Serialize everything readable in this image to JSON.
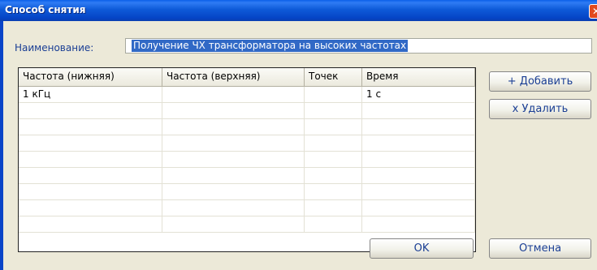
{
  "window": {
    "title": "Способ снятия",
    "close_glyph": "✕"
  },
  "form": {
    "name_label": "Наименование:",
    "name_value": "Получение ЧХ трансформатора на высоких частотах"
  },
  "grid": {
    "columns": [
      "Частота (нижняя)",
      "Частота (верхняя)",
      "Точек",
      "Время"
    ],
    "rows": [
      [
        "1 кГц",
        "",
        "",
        "1 с"
      ]
    ],
    "empty_row_count": 8
  },
  "buttons": {
    "add": "+ Добавить",
    "delete": "x Удалить",
    "ok": "OK",
    "cancel": "Отмена"
  },
  "colors": {
    "titlebar": "#0a5fe8",
    "face": "#ece9d8",
    "label_text": "#1a3e94",
    "selection": "#3169c6"
  }
}
